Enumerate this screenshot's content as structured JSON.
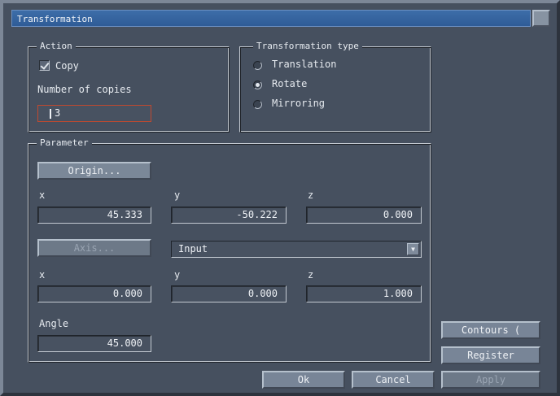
{
  "window": {
    "title": "Transformation"
  },
  "action": {
    "group_title": "Action",
    "copy_label": "Copy",
    "copy_checked": true,
    "copies_label": "Number of copies",
    "copies_value": "3"
  },
  "transformation_type": {
    "group_title": "Transformation type",
    "options": [
      {
        "label": "Translation",
        "selected": false
      },
      {
        "label": "Rotate",
        "selected": true
      },
      {
        "label": "Mirroring",
        "selected": false
      }
    ]
  },
  "parameter": {
    "group_title": "Parameter",
    "origin_button": "Origin...",
    "origin": {
      "x_label": "x",
      "y_label": "y",
      "z_label": "z",
      "x": "45.333",
      "y": "-50.222",
      "z": "0.000"
    },
    "axis_button": "Axis...",
    "axis_mode": "Input",
    "axis": {
      "x_label": "x",
      "y_label": "y",
      "z_label": "z",
      "x": "0.000",
      "y": "0.000",
      "z": "1.000"
    },
    "angle_label": "Angle",
    "angle_value": "45.000"
  },
  "side_buttons": {
    "contours": "Contours (",
    "register": "Register",
    "apply": "Apply"
  },
  "footer": {
    "ok": "Ok",
    "cancel": "Cancel"
  },
  "icons": {
    "checkbox": "check-icon",
    "radio": "radio-icon",
    "dropdown": "chevron-down-icon"
  }
}
